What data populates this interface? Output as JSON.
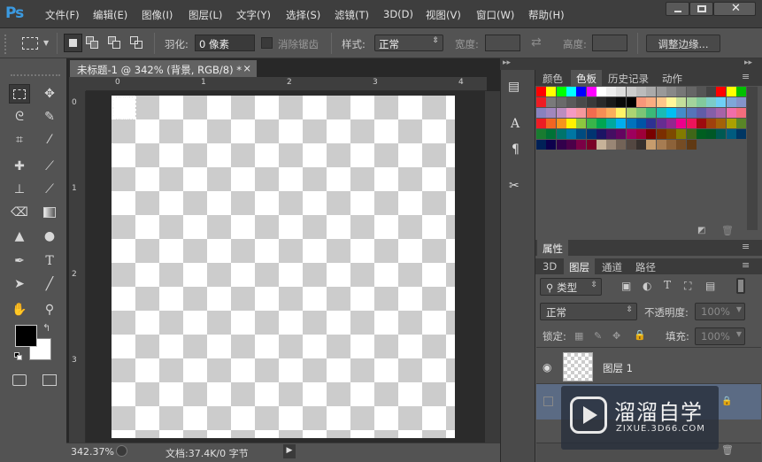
{
  "app": {
    "logo": "Ps"
  },
  "menu": [
    "文件(F)",
    "编辑(E)",
    "图像(I)",
    "图层(L)",
    "文字(Y)",
    "选择(S)",
    "滤镜(T)",
    "3D(D)",
    "视图(V)",
    "窗口(W)",
    "帮助(H)"
  ],
  "options": {
    "feather_label": "羽化:",
    "feather_value": "0 像素",
    "antialias_label": "消除锯齿",
    "style_label": "样式:",
    "style_value": "正常",
    "width_label": "宽度:",
    "height_label": "高度:",
    "refine_button": "调整边缘..."
  },
  "document": {
    "tab_title": "未标题-1 @ 342% (背景, RGB/8) *",
    "close": "×",
    "hruler_ticks": [
      "0",
      "1",
      "2",
      "3",
      "4"
    ],
    "vruler_ticks": [
      "0",
      "1",
      "2",
      "3"
    ]
  },
  "status": {
    "zoom": "342.37%",
    "doc": "文档:37.4K/0 字节"
  },
  "panels": {
    "swatch_tabs": [
      "颜色",
      "色板",
      "历史记录",
      "动作"
    ],
    "properties_tab": "属性",
    "layer_tabs": [
      "3D",
      "图层",
      "通道",
      "路径"
    ],
    "filter_kind": "类型",
    "blend_mode": "正常",
    "opacity_label": "不透明度:",
    "opacity_value": "100%",
    "lock_label": "锁定:",
    "fill_label": "填充:",
    "fill_value": "100%",
    "layer1_name": "图层 1"
  },
  "watermark": {
    "title": "溜溜自学",
    "url": "ZIXUE.3D66.COM"
  },
  "colors": {
    "accent": "#3b9ae1",
    "bg": "#535353",
    "dark": "#282828"
  },
  "swatches": {
    "row1": [
      "#ff0000",
      "#ffff00",
      "#00ff00",
      "#00ffff",
      "#0000ff",
      "#ff00ff",
      "#ffffff",
      "#eeeeee",
      "#dddddd",
      "#cccccc",
      "#bbbbbb",
      "#aaaaaa",
      "#999999",
      "#888888",
      "#777777",
      "#666666",
      "#555555",
      "#444444",
      "#ff0000",
      "#ffff00",
      "#00c000"
    ],
    "row2": [
      "#ed1c24",
      "#7a7a7a",
      "#6a6a6a",
      "#5a5a5a",
      "#4a4a4a",
      "#3a3a3a",
      "#2a2a2a",
      "#1a1a1a",
      "#0a0a0a",
      "#000000",
      "#f7977a",
      "#f9ad81",
      "#fdc68a",
      "#fff79a",
      "#c4df9b",
      "#a3d39c",
      "#82ca9d",
      "#7bcdc8",
      "#6ecff6",
      "#7ea7d8",
      "#8493ca"
    ],
    "row3": [
      "#8882be",
      "#a187be",
      "#bc8dbf",
      "#f49ac2",
      "#f6989d",
      "#f26c4f",
      "#f68e55",
      "#fbaf5c",
      "#fff467",
      "#acd372",
      "#7cc576",
      "#3bb878",
      "#1abbb4",
      "#00bff3",
      "#438ccb",
      "#5574b9",
      "#605ca8",
      "#855fa8",
      "#a763a8",
      "#f06ea9",
      "#f26d7d"
    ],
    "row4": [
      "#ed1c24",
      "#f26522",
      "#f7941d",
      "#fff200",
      "#8dc73f",
      "#39b54a",
      "#00a651",
      "#00a99d",
      "#00aeef",
      "#0072bc",
      "#0054a6",
      "#2e3192",
      "#662d91",
      "#92278f",
      "#ec008c",
      "#ed145b",
      "#9e0b0f",
      "#a0410d",
      "#a36209",
      "#aba000",
      "#598527"
    ],
    "row5": [
      "#197b30",
      "#007236",
      "#00746b",
      "#0076a3",
      "#004b80",
      "#003471",
      "#1b1464",
      "#440e62",
      "#630460",
      "#9e005d",
      "#9e0039",
      "#790000",
      "#7b2e00",
      "#7d4900",
      "#827b00",
      "#406618",
      "#005e20",
      "#005826",
      "#005952",
      "#005b7f",
      "#003663"
    ],
    "row6": [
      "#002157",
      "#0d004c",
      "#32004b",
      "#4b0049",
      "#7b0046",
      "#7a0026",
      "#c7b299",
      "#998675",
      "#736357",
      "#534741",
      "#37302d",
      "#c69c6d",
      "#a67c52",
      "#8c6239",
      "#754c24",
      "#603913"
    ]
  }
}
